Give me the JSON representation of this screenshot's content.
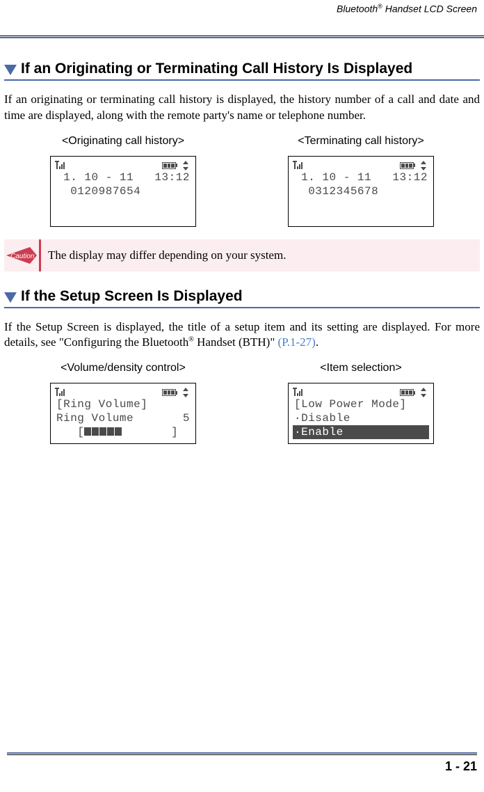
{
  "header": {
    "running_title_pre": "Bluetooth",
    "running_title_sup": "®",
    "running_title_post": " Handset LCD Screen"
  },
  "section1": {
    "heading": "If an Originating or Terminating Call History Is Displayed",
    "body": "If an originating or terminating call history is displayed, the history number of a call and date and time are displayed, along with the remote party's name or telephone number.",
    "left_caption": "<Originating call history>",
    "right_caption": "<Terminating call history>",
    "left_lcd_line1": " 1. 10 - 11   13:12",
    "left_lcd_line2": "  0120987654",
    "right_lcd_line1": " 1. 10 - 11   13:12",
    "right_lcd_line2": "  0312345678"
  },
  "caution": {
    "label": "Caution",
    "text": "The display may differ depending on your system."
  },
  "section2": {
    "heading": "If the Setup Screen Is Displayed",
    "body_pre": "If the Setup Screen is displayed, the title of a setup item and its setting are displayed. For more details, see \"Configuring the Bluetooth",
    "body_sup": "®",
    "body_post": " Handset (BTH)\"  ",
    "body_link": "(P.1-27)",
    "body_end": ".",
    "left_caption": "<Volume/density control>",
    "right_caption": "<Item selection>",
    "vol_line1": "[Ring Volume]",
    "vol_line2": "Ring Volume       5",
    "vol_line3_pre": "   [",
    "vol_line3_post": "       ]",
    "item_line1": "[Low Power Mode]",
    "item_line2": "·Disable",
    "item_line3": "·Enable"
  },
  "footer": {
    "page": "1 - 21"
  }
}
